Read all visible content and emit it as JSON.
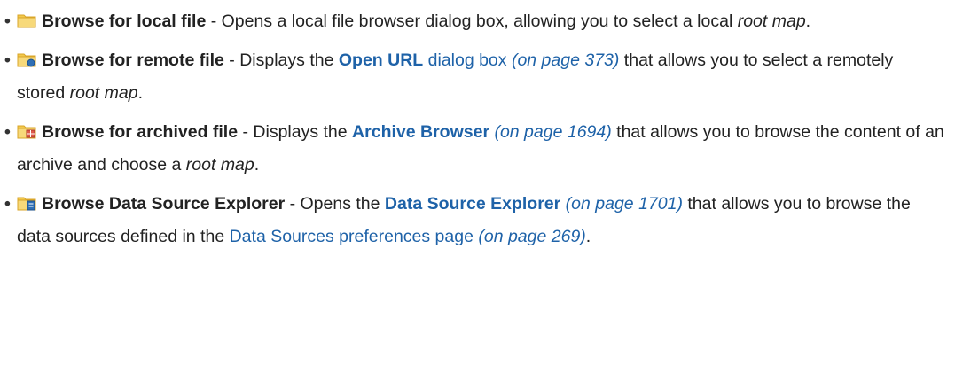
{
  "items": [
    {
      "icon": "folder-icon",
      "term": "Browse for local file",
      "text1": " - Opens a local file browser dialog box, allowing you to select a local ",
      "italic": "root map",
      "text2": "."
    },
    {
      "icon": "folder-remote-icon",
      "term": "Browse for remote file",
      "text1": " - Displays the ",
      "link_strong": "Open URL",
      "link_normal": " dialog box",
      "page_ref": "(on page 373)",
      "text2": " that allows you to select a remotely stored ",
      "italic": "root map",
      "text3": "."
    },
    {
      "icon": "folder-archive-icon",
      "term": "Browse for archived file",
      "text1": " - Displays the ",
      "link_strong": "Archive Browser",
      "page_ref": "(on page 1694)",
      "text2": " that allows you to browse the content of an archive and choose a ",
      "italic": "root map",
      "text3": "."
    },
    {
      "icon": "folder-datasource-icon",
      "term": "Browse Data Source Explorer",
      "text1": " - Opens the ",
      "link_strong": "Data Source Explorer",
      "page_ref": "(on page 1701)",
      "text2": " that allows you to browse the data sources defined in the ",
      "link_normal": "Data Sources preferences page",
      "page_ref2": "(on page 269)",
      "text3": "."
    }
  ],
  "colors": {
    "link": "#1e62a8",
    "folder": "#f2c94c",
    "folder_dark": "#d9a528"
  }
}
